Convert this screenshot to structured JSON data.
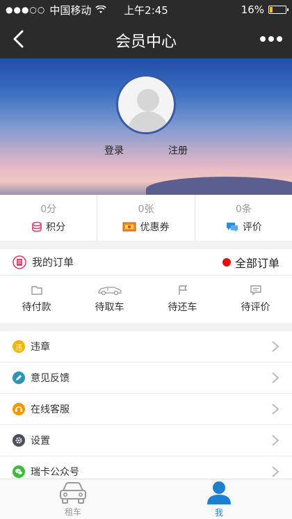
{
  "status_bar": {
    "signal": "●●●○○",
    "carrier": "中国移动",
    "time": "上午2:45",
    "battery": "16%",
    "battery_level": 0.16
  },
  "nav": {
    "title": "会员中心",
    "back_icon": "chevron-left-icon",
    "more_icon": "more-dots-icon"
  },
  "profile": {
    "login": "登录",
    "register": "注册"
  },
  "stats": [
    {
      "value": "0分",
      "label": "积分",
      "icon": "coins-icon",
      "color": "#e0406b"
    },
    {
      "value": "0张",
      "label": "优惠券",
      "icon": "coupon-icon",
      "color": "#f08a24"
    },
    {
      "value": "0条",
      "label": "评价",
      "icon": "comment-icon",
      "color": "#2b8de0"
    }
  ],
  "orders": {
    "title": "我的订单",
    "all_label": "全部订单",
    "items": [
      {
        "label": "待付款",
        "icon": "wallet-icon"
      },
      {
        "label": "待取车",
        "icon": "car-icon"
      },
      {
        "label": "待还车",
        "icon": "flag-icon"
      },
      {
        "label": "待评价",
        "icon": "message-icon"
      }
    ]
  },
  "menu": [
    {
      "label": "违章",
      "icon": "violation-icon",
      "color": "#f5b400"
    },
    {
      "label": "意见反馈",
      "icon": "pencil-icon",
      "color": "#2d95b8"
    },
    {
      "label": "在线客服",
      "icon": "headset-icon",
      "color": "#f39a00"
    },
    {
      "label": "设置",
      "icon": "gear-icon",
      "color": "#4a4f5a"
    },
    {
      "label": "瑞卡公众号",
      "icon": "wechat-icon",
      "color": "#3dbb3d"
    }
  ],
  "tabs": [
    {
      "label": "租车",
      "icon": "car-front-icon",
      "active": false
    },
    {
      "label": "我",
      "icon": "user-icon",
      "active": true
    }
  ],
  "colors": {
    "header_bg": "#2b2b2b",
    "accent": "#1e7fd1",
    "red_dot": "#e01010"
  }
}
